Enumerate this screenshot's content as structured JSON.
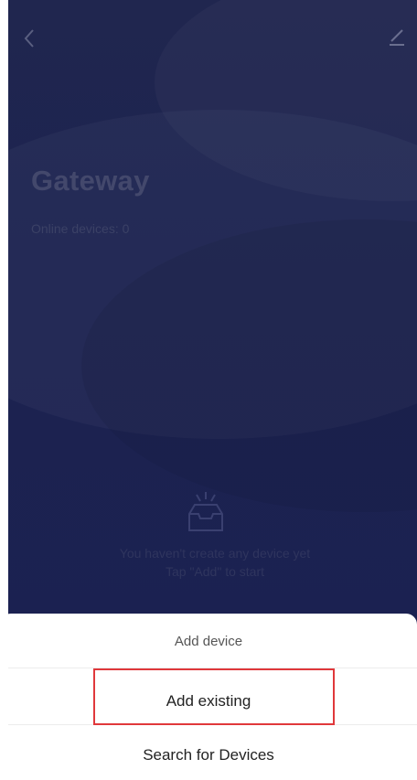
{
  "header": {
    "back_icon": "chevron-left-icon",
    "edit_icon": "pencil-icon"
  },
  "gateway": {
    "title": "Gateway",
    "online_devices": "Online devices: 0"
  },
  "empty_state": {
    "icon": "empty-inbox-icon",
    "line1": "You haven't create any device yet",
    "line2": "Tap \"Add\" to start"
  },
  "sheet": {
    "title": "Add device",
    "options": [
      {
        "label": "Add existing"
      },
      {
        "label": "Search for Devices"
      }
    ]
  },
  "colors": {
    "background": "#1c2350",
    "title": "#43486c",
    "highlight": "#e0383b"
  }
}
